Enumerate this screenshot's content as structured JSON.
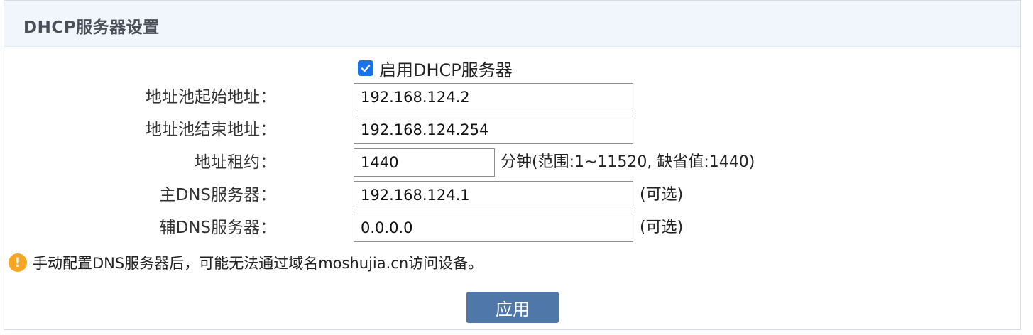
{
  "panel": {
    "title": "DHCP服务器设置"
  },
  "enable": {
    "checked": true,
    "label": "启用DHCP服务器"
  },
  "fields": {
    "pool_start": {
      "label": "地址池起始地址：",
      "value": "192.168.124.2"
    },
    "pool_end": {
      "label": "地址池结束地址：",
      "value": "192.168.124.254"
    },
    "lease": {
      "label": "地址租约：",
      "value": "1440",
      "suffix": "分钟(范围:1~11520, 缺省值:1440)"
    },
    "primary_dns": {
      "label": "主DNS服务器：",
      "value": "192.168.124.1",
      "suffix": "(可选)"
    },
    "secondary_dns": {
      "label": "辅DNS服务器：",
      "value": "0.0.0.0",
      "suffix": "(可选)"
    }
  },
  "warning": {
    "icon": "exclamation-icon",
    "icon_glyph": "!",
    "text": "手动配置DNS服务器后，可能无法通过域名moshujia.cn访问设备。"
  },
  "apply_button": {
    "label": "应用"
  },
  "colors": {
    "header_bg": "#f1f6fd",
    "checkbox": "#1a73e8",
    "warning": "#f5a623",
    "button": "#4f77a8"
  }
}
